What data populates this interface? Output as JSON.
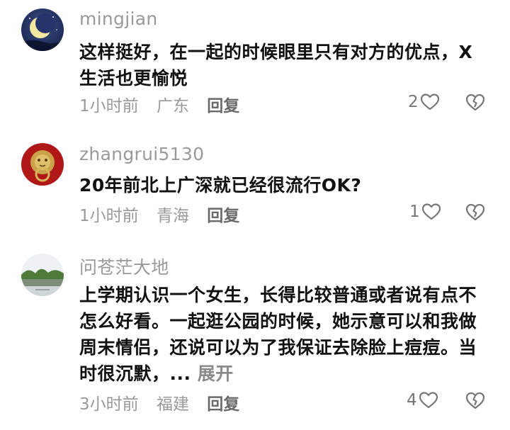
{
  "comments": [
    {
      "username": "mingjian",
      "text": "这样挺好，在一起的时候眼里只有对方的优点，X生活也更愉悦",
      "time": "1小时前",
      "location": "广东",
      "reply_label": "回复",
      "like_count": "2"
    },
    {
      "username": "zhangrui5130",
      "text": "20年前北上广深就已经很流行OK?",
      "time": "1小时前",
      "location": "青海",
      "reply_label": "回复",
      "like_count": "1"
    },
    {
      "username": "问苍茫大地",
      "text": "上学期认识一个女生，长得比较普通或者说有点不怎么好看。一起逛公园的时候，她示意可以和我做周末情侣，还说可以为了我保证去除脸上痘痘。当时很沉默，... ",
      "expand_label": "展开",
      "time": "3小时前",
      "location": "福建",
      "reply_label": "回复",
      "like_count": "4"
    }
  ],
  "colors": {
    "username": "#9a9a9a",
    "body_text": "#111111",
    "meta": "#9a9a9a",
    "icon": "#777777"
  }
}
